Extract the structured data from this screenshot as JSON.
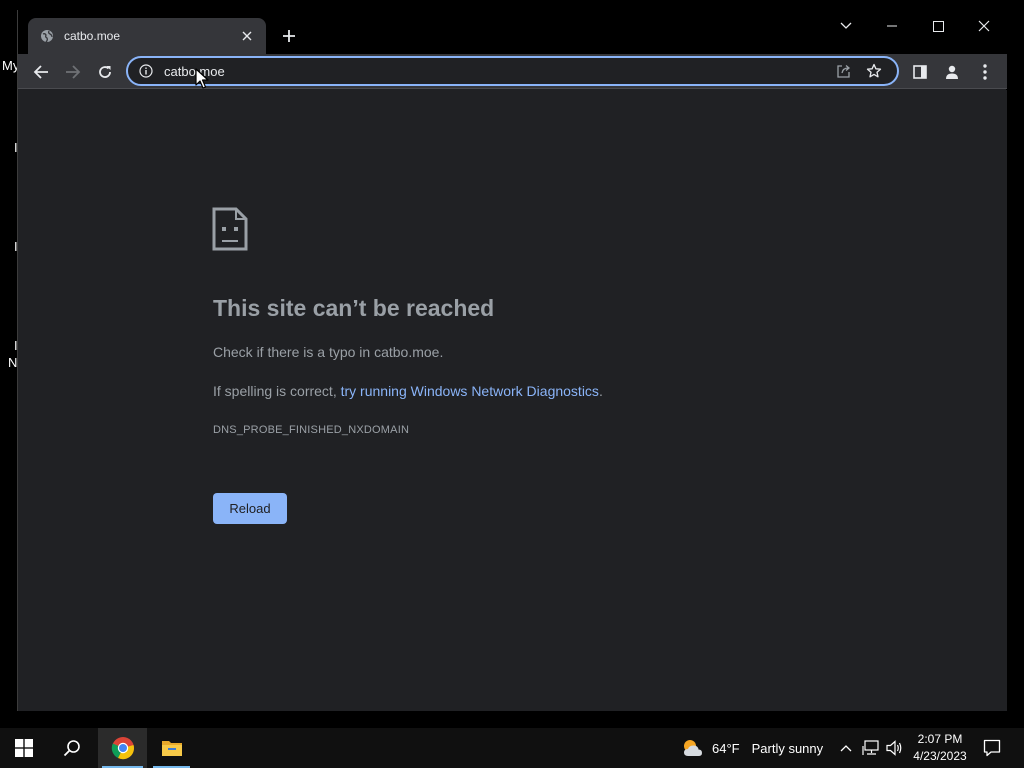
{
  "desktop": {
    "fragments": [
      "My",
      "I",
      "I",
      "I",
      "N"
    ]
  },
  "browser": {
    "tab": {
      "title": "catbo.moe",
      "favicon": "globe-icon"
    },
    "address": {
      "url": "catbo.moe"
    },
    "colors": {
      "accent": "#8ab4f8",
      "page_bg": "#202124",
      "toolbar_bg": "#35363a"
    }
  },
  "error_page": {
    "title": "This site can’t be reached",
    "line1": "Check if there is a typo in catbo.moe.",
    "line2_prefix": "If spelling is correct, ",
    "line2_link": "try running Windows Network Diagnostics",
    "line2_suffix": ".",
    "error_code": "DNS_PROBE_FINISHED_NXDOMAIN",
    "reload_label": "Reload"
  },
  "taskbar": {
    "weather": {
      "temp": "64°F",
      "condition": "Partly sunny"
    },
    "clock": {
      "time": "2:07 PM",
      "date": "4/23/2023"
    }
  }
}
